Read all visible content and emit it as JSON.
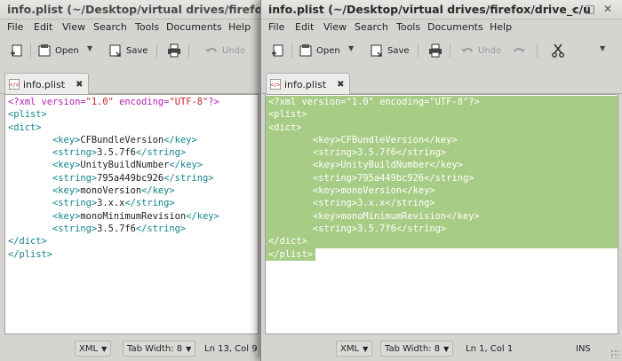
{
  "left_window": {
    "title": "info.plist (~/Desktop/virtual drives/firefox/d",
    "menu": [
      "File",
      "Edit",
      "View",
      "Search",
      "Tools",
      "Documents",
      "Help"
    ],
    "toolbar": {
      "open_label": "Open",
      "save_label": "Save",
      "undo_label": "Undo"
    },
    "tab_label": "info.plist",
    "status": {
      "language": "XML",
      "tab_width": "Tab Width:  8",
      "position": "Ln 13, Col 9"
    }
  },
  "right_window": {
    "title": "info.plist (~/Desktop/virtual drives/firefox/drive_c/u",
    "menu": [
      "File",
      "Edit",
      "View",
      "Search",
      "Tools",
      "Documents",
      "Help"
    ],
    "toolbar": {
      "open_label": "Open",
      "save_label": "Save",
      "undo_label": "Undo"
    },
    "tab_label": "info.plist",
    "status": {
      "language": "XML",
      "tab_width": "Tab Width:  8",
      "position": "Ln 1, Col 1",
      "mode": "INS"
    }
  },
  "document_lines": [
    "<?xml version=\"1.0\" encoding=\"UTF-8\"?>",
    "<plist>",
    "<dict>",
    "        <key>CFBundleVersion</key>",
    "        <string>3.5.7f6</string>",
    "        <key>UnityBuildNumber</key>",
    "        <string>795a449bc926</string>",
    "        <key>monoVersion</key>",
    "        <string>3.x.x</string>",
    "        <key>monoMinimumRevision</key>",
    "        <string>3.5.7f6</string>",
    "</dict>",
    "</plist>"
  ],
  "colors": {
    "selection": "#a7cc85",
    "tag": "#13838a",
    "declaration": "#b01cb0",
    "attribute_value": "#c81e1e"
  },
  "icons": [
    "new-document-icon",
    "open-folder-icon",
    "save-icon",
    "print-icon",
    "undo-icon",
    "redo-icon",
    "cut-icon",
    "xml-file-icon",
    "close-tab-icon"
  ]
}
